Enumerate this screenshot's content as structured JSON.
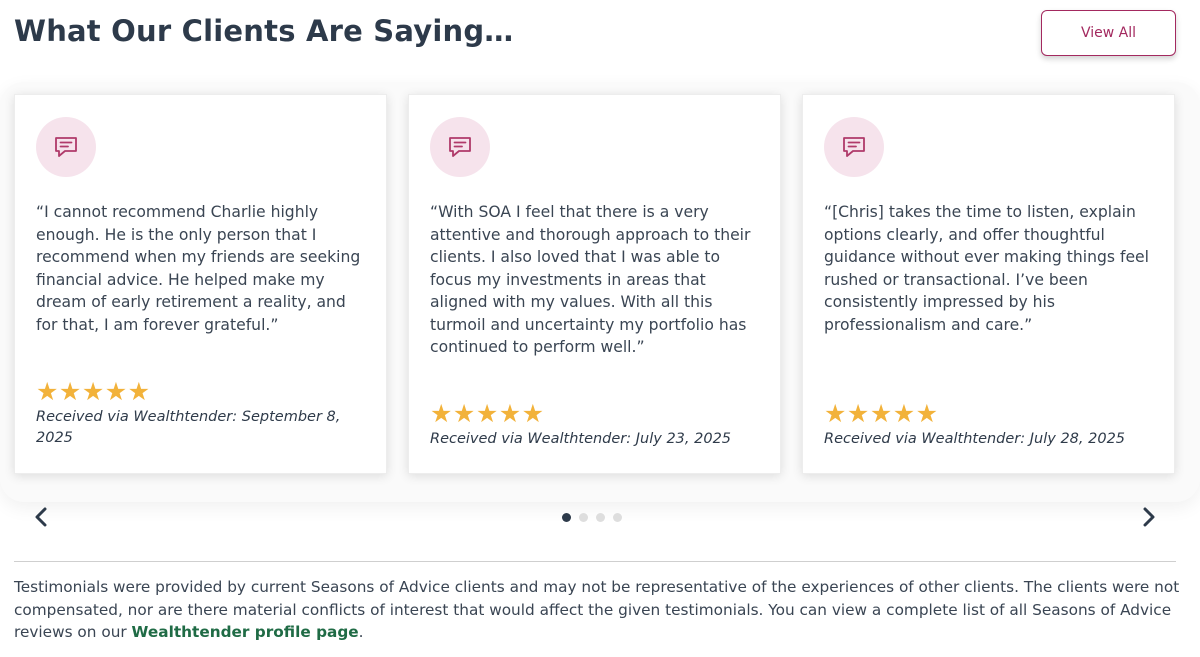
{
  "header": {
    "title": "What Our Clients Are Saying…",
    "view_all_label": "View All"
  },
  "testimonials": [
    {
      "quote": "“I cannot recommend Charlie highly enough. He is the only person that I recommend when my friends are seeking financial advice. He helped make my dream of early retirement a reality, and for that, I am forever grateful.”",
      "stars": "★★★★★",
      "rating": 5,
      "received": "Received via Wealthtender: September 8, 2025"
    },
    {
      "quote": "“With SOA I feel that there is a very attentive and thorough approach to their clients. I also loved that I was able to focus my investments in areas that aligned with my values. With all this turmoil and uncertainty my portfolio has continued to perform well.”",
      "stars": "★★★★★",
      "rating": 5,
      "received": "Received via Wealthtender: July 23, 2025"
    },
    {
      "quote": "“[Chris] takes the time to listen, explain options clearly, and offer thoughtful guidance without ever making things feel rushed or transactional. I’ve been consistently impressed by his professionalism and care.”",
      "stars": "★★★★★",
      "rating": 5,
      "received": "Received via Wealthtender: July 28, 2025"
    }
  ],
  "carousel": {
    "prev_icon": "chevron-left-icon",
    "next_icon": "chevron-right-icon",
    "page_count": 4,
    "active_page": 1
  },
  "disclaimer": {
    "text": "Testimonials were provided by current Seasons of Advice clients and may not be representative of the experiences of other clients. The clients were not compensated, nor are there material conflicts of interest that would affect the given testimonials. You can view a complete list of all Seasons of Advice reviews on our ",
    "link_label": "Wealthtender profile page",
    "end": "."
  },
  "colors": {
    "accent": "#a3295f",
    "icon_bg": "#f6e3ec",
    "star": "#f2b23a",
    "link": "#1f6b45",
    "heading": "#2d3a4a"
  }
}
